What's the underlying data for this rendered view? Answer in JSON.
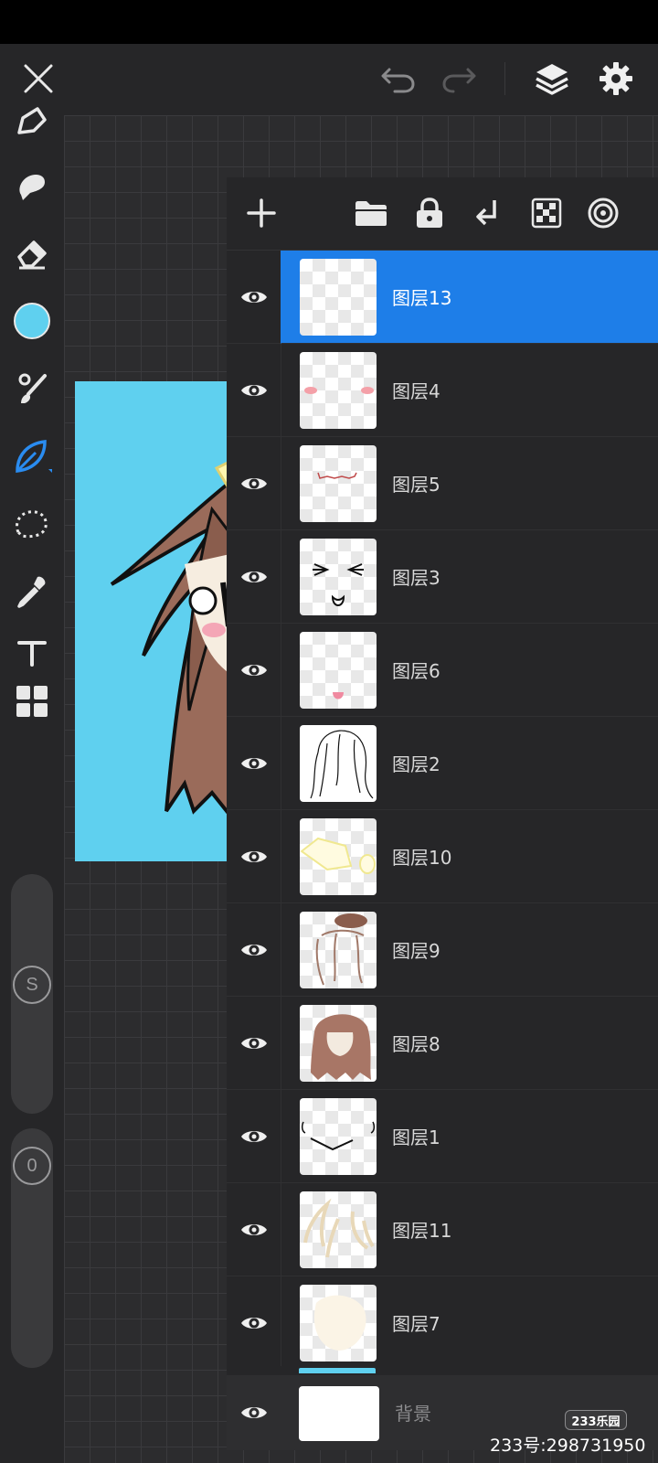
{
  "colors": {
    "accent": "#1e7ee8",
    "current_color": "#5fd0ef",
    "panel_bg": "#262628"
  },
  "topbar": {
    "icons": [
      "close-icon",
      "undo-icon",
      "redo-icon",
      "layers-icon",
      "gear-icon"
    ]
  },
  "left_toolbar": {
    "icons": [
      "pen-icon",
      "smudge-icon",
      "eraser-icon",
      "color-swatch",
      "brush-icon",
      "leaf-brush-icon",
      "lasso-icon",
      "eyedropper-icon",
      "text-icon",
      "grid-icon"
    ],
    "size_slider_label": "S",
    "opacity_slider_label": "0"
  },
  "layers_panel": {
    "toolbar_icons": [
      "add-icon",
      "folder-icon",
      "lock-icon",
      "merge-down-icon",
      "transparency-icon",
      "blend-mode-icon"
    ],
    "layers": [
      {
        "name": "图层13",
        "selected": true,
        "visible": true
      },
      {
        "name": "图层4",
        "selected": false,
        "visible": true
      },
      {
        "name": "图层5",
        "selected": false,
        "visible": true
      },
      {
        "name": "图层3",
        "selected": false,
        "visible": true
      },
      {
        "name": "图层6",
        "selected": false,
        "visible": true
      },
      {
        "name": "图层2",
        "selected": false,
        "visible": true
      },
      {
        "name": "图层10",
        "selected": false,
        "visible": true
      },
      {
        "name": "图层9",
        "selected": false,
        "visible": true
      },
      {
        "name": "图层8",
        "selected": false,
        "visible": true
      },
      {
        "name": "图层1",
        "selected": false,
        "visible": true
      },
      {
        "name": "图层11",
        "selected": false,
        "visible": true
      },
      {
        "name": "图层7",
        "selected": false,
        "visible": true
      }
    ],
    "background_layer": {
      "name": "背景",
      "visible": true
    }
  },
  "watermark": {
    "logo": "233乐园",
    "text": "233号:298731950"
  }
}
